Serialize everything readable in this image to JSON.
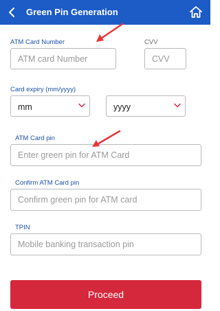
{
  "header": {
    "title": "Green Pin Generation",
    "back_icon": "chevron-left-icon",
    "home_icon": "home-icon",
    "bg_color": "#1d5bc6"
  },
  "form": {
    "atm_card_number": {
      "label": "ATM Card Number",
      "placeholder": "ATM card Number",
      "value": ""
    },
    "cvv": {
      "label": "CVV",
      "placeholder": "CVV",
      "value": ""
    },
    "card_expiry": {
      "label": "Card expiry (mm/yyyy)",
      "month": {
        "selected": "mm"
      },
      "year": {
        "selected": "yyyy"
      },
      "chevron_icon": "chevron-down-icon"
    },
    "atm_card_pin": {
      "label": "ATM Card pin",
      "placeholder": "Enter green pin for ATM Card",
      "value": ""
    },
    "confirm_atm_card_pin": {
      "label": "Confirm ATM Card pin",
      "placeholder": "Confirm green pin for ATM card",
      "value": ""
    },
    "tpin": {
      "label": "TPIN",
      "placeholder": "Mobile banking transaction pin",
      "value": ""
    }
  },
  "actions": {
    "proceed_label": "Proceed",
    "proceed_color": "#d5283c"
  },
  "annotations": {
    "arrow_color": "#e8363a"
  }
}
